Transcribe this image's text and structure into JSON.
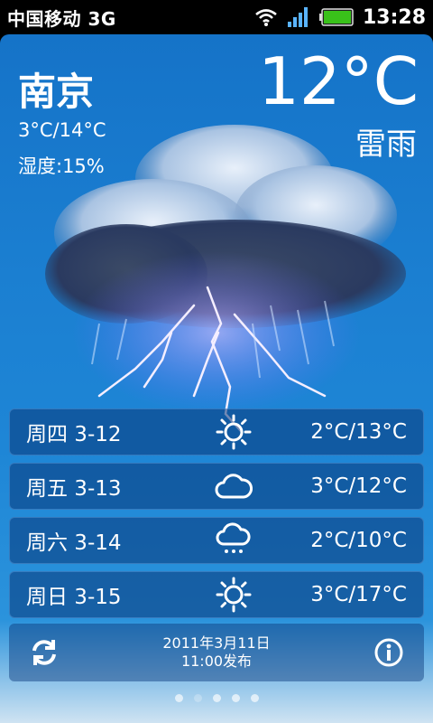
{
  "status": {
    "carrier": "中国移动 3G",
    "time": "13:28",
    "icons": [
      "wifi-icon",
      "signal-icon",
      "battery-icon"
    ]
  },
  "weather": {
    "city": "南京",
    "range": "3°C/14°C",
    "humidity": "湿度:15%",
    "current_temp": "12°C",
    "condition": "雷雨"
  },
  "forecast": [
    {
      "day": "周四 3-12",
      "icon": "sunny-icon",
      "temp": "2°C/13°C"
    },
    {
      "day": "周五 3-13",
      "icon": "cloudy-icon",
      "temp": "3°C/12°C"
    },
    {
      "day": "周六 3-14",
      "icon": "rain-icon",
      "temp": "2°C/10°C"
    },
    {
      "day": "周日 3-15",
      "icon": "sunny-icon",
      "temp": "3°C/17°C"
    }
  ],
  "footer": {
    "date": "2011年3月11日",
    "published": "11:00发布"
  },
  "pager": {
    "pages": 5,
    "active": 0
  },
  "colors": {
    "accent": "#1b7fd1",
    "row": "#083678",
    "battery": "#39c11a"
  }
}
